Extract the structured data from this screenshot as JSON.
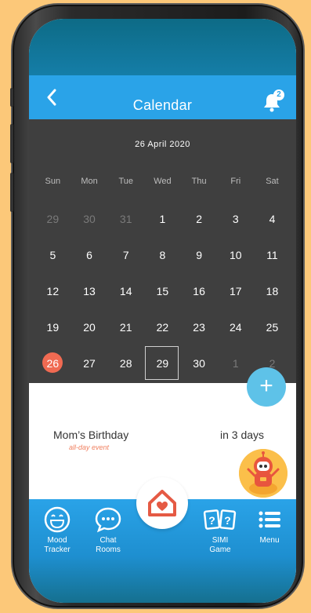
{
  "header": {
    "title": "Calendar",
    "notification_count": "2"
  },
  "calendar": {
    "month_label": "26 April 2020",
    "weekdays": [
      "Sun",
      "Mon",
      "Tue",
      "Wed",
      "Thu",
      "Fri",
      "Sat"
    ],
    "weeks": [
      [
        "29",
        "30",
        "31",
        "1",
        "2",
        "3",
        "4"
      ],
      [
        "5",
        "6",
        "7",
        "8",
        "9",
        "10",
        "11"
      ],
      [
        "12",
        "13",
        "14",
        "15",
        "16",
        "17",
        "18"
      ],
      [
        "19",
        "20",
        "21",
        "22",
        "23",
        "24",
        "25"
      ],
      [
        "26",
        "27",
        "28",
        "29",
        "30",
        "1",
        "2"
      ]
    ]
  },
  "fab": {
    "label": "+"
  },
  "event": {
    "title": "Mom’s Birthday",
    "subtitle": "all-day event",
    "when": "in 3 days"
  },
  "tabbar": {
    "mood": "Mood Tracker",
    "chat": "Chat Rooms",
    "game": "SIMI Game",
    "menu": "Menu"
  },
  "colors": {
    "accent_blue": "#2aa3e8",
    "today_red": "#f06a52",
    "calendar_bg": "#3f3f3f",
    "home_red": "#e55a44"
  }
}
